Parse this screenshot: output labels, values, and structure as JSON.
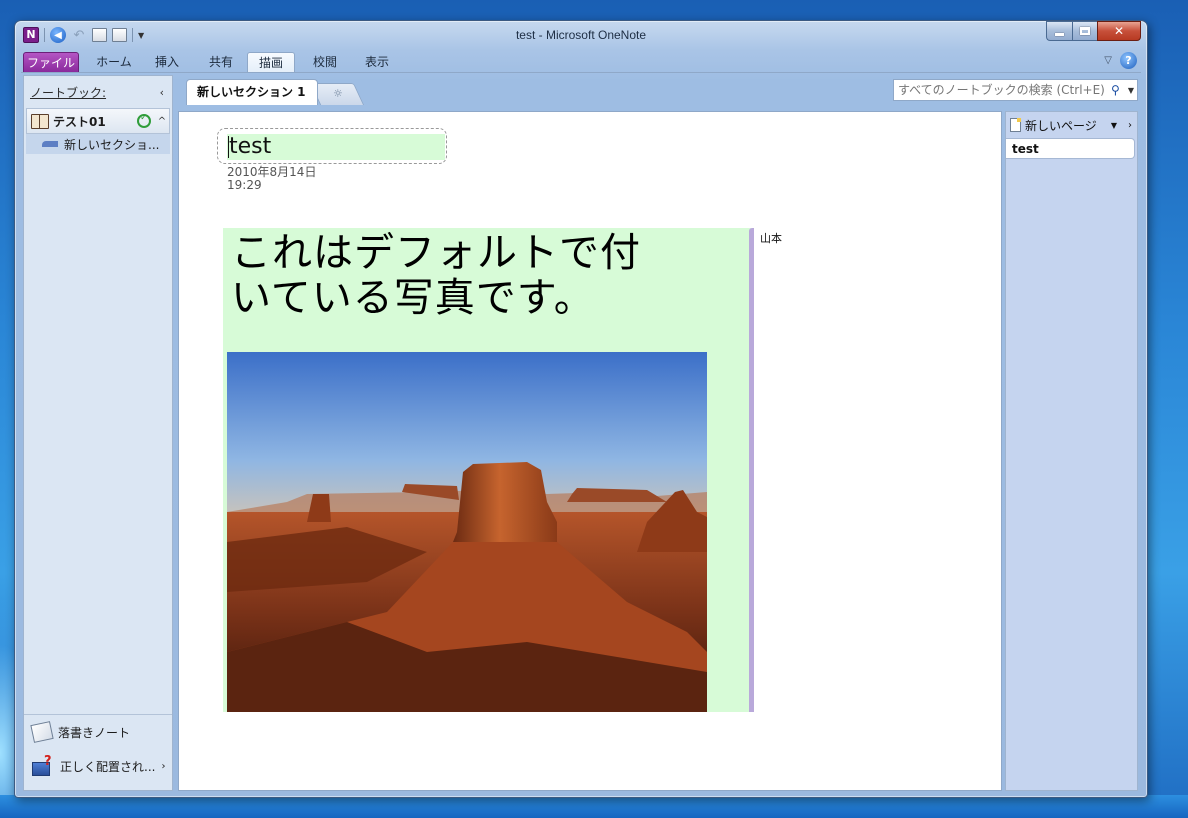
{
  "window": {
    "title": "test - Microsoft OneNote"
  },
  "qat": {
    "app_icon_letter": "N"
  },
  "ribbon": {
    "tabs": [
      {
        "label": "ファイル",
        "kind": "file"
      },
      {
        "label": "ホーム"
      },
      {
        "label": "挿入"
      },
      {
        "label": "共有"
      },
      {
        "label": "描画",
        "active": true
      },
      {
        "label": "校閲"
      },
      {
        "label": "表示"
      }
    ],
    "help_label": "?"
  },
  "nav": {
    "header_label": "ノートブック:",
    "collapse_glyph": "‹",
    "notebook": {
      "label": "テスト01",
      "chevron": "^"
    },
    "section": {
      "label": "新しいセクショ..."
    },
    "bottom": {
      "unfiled_label": "落書きノート",
      "misplaced_label": "正しく配置され...",
      "more_glyph": "›"
    }
  },
  "section_tabs": {
    "active": "新しいセクション 1",
    "new_icon": "☼"
  },
  "search": {
    "placeholder": "すべてのノートブックの検索 (Ctrl+E)",
    "icon": "search-icon"
  },
  "page": {
    "title": "test",
    "date": "2010年8月14日",
    "time": "19:29",
    "note_lines": [
      "これはデフォルトで付",
      "いている写真です。"
    ],
    "author": "山本",
    "photo_desc_icon": "desert-photo"
  },
  "page_list": {
    "new_page_label": "新しいページ",
    "pages": [
      "test"
    ]
  },
  "colors": {
    "file_tab": "#8a2a9c",
    "note_highlight": "#d7fbd7",
    "author_bar": "#b9a9da",
    "page_list_bg": "#c5d4ef"
  }
}
